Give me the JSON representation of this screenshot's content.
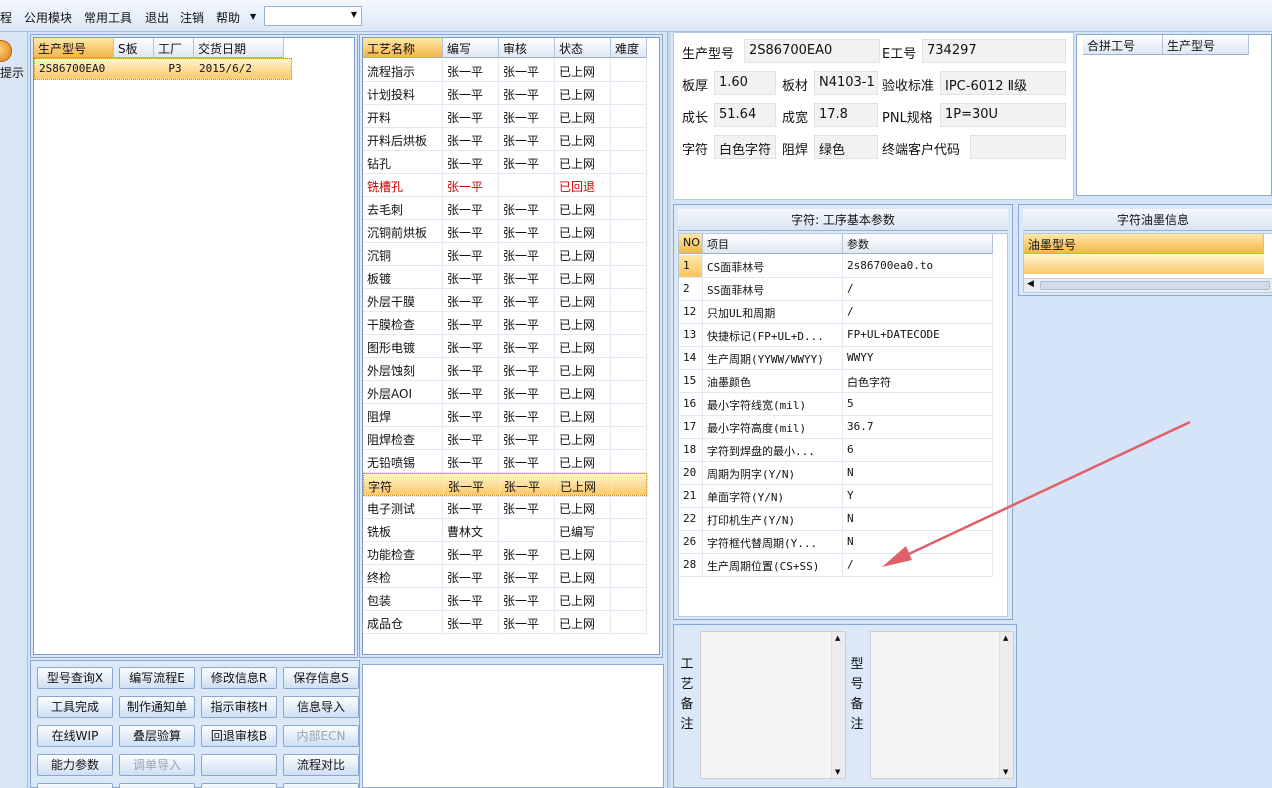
{
  "menu": {
    "items": [
      "程",
      "公用模块",
      "常用工具",
      "退出",
      "注销",
      "帮助"
    ],
    "combo_value": ""
  },
  "leftstrip": {
    "tip_label": "提示"
  },
  "order_grid": {
    "columns": [
      "生产型号",
      "S板",
      "工厂",
      "交货日期"
    ],
    "rows": [
      [
        "2S86700EA0",
        "",
        "P3",
        "2015/6/2"
      ]
    ]
  },
  "process_grid": {
    "columns": [
      "工艺名称",
      "编写",
      "审核",
      "状态",
      "难度"
    ],
    "rows": [
      [
        "流程指示",
        "张一平",
        "张一平",
        "已上网",
        ""
      ],
      [
        "计划投料",
        "张一平",
        "张一平",
        "已上网",
        ""
      ],
      [
        "开料",
        "张一平",
        "张一平",
        "已上网",
        ""
      ],
      [
        "开料后烘板",
        "张一平",
        "张一平",
        "已上网",
        ""
      ],
      [
        "钻孔",
        "张一平",
        "张一平",
        "已上网",
        ""
      ],
      [
        "铣槽孔",
        "张一平",
        "",
        "已回退",
        ""
      ],
      [
        "去毛刺",
        "张一平",
        "张一平",
        "已上网",
        ""
      ],
      [
        "沉铜前烘板",
        "张一平",
        "张一平",
        "已上网",
        ""
      ],
      [
        "沉铜",
        "张一平",
        "张一平",
        "已上网",
        ""
      ],
      [
        "板镀",
        "张一平",
        "张一平",
        "已上网",
        ""
      ],
      [
        "外层干膜",
        "张一平",
        "张一平",
        "已上网",
        ""
      ],
      [
        "干膜检查",
        "张一平",
        "张一平",
        "已上网",
        ""
      ],
      [
        "图形电镀",
        "张一平",
        "张一平",
        "已上网",
        ""
      ],
      [
        "外层蚀刻",
        "张一平",
        "张一平",
        "已上网",
        ""
      ],
      [
        "外层AOI",
        "张一平",
        "张一平",
        "已上网",
        ""
      ],
      [
        "阻焊",
        "张一平",
        "张一平",
        "已上网",
        ""
      ],
      [
        "阻焊检查",
        "张一平",
        "张一平",
        "已上网",
        ""
      ],
      [
        "无铅喷锡",
        "张一平",
        "张一平",
        "已上网",
        ""
      ],
      [
        "字符",
        "张一平",
        "张一平",
        "已上网",
        ""
      ],
      [
        "电子测试",
        "张一平",
        "张一平",
        "已上网",
        ""
      ],
      [
        "铣板",
        "曹林文",
        "",
        "已编写",
        ""
      ],
      [
        "功能检查",
        "张一平",
        "张一平",
        "已上网",
        ""
      ],
      [
        "终检",
        "张一平",
        "张一平",
        "已上网",
        ""
      ],
      [
        "包装",
        "张一平",
        "张一平",
        "已上网",
        ""
      ],
      [
        "成品仓",
        "张一平",
        "张一平",
        "已上网",
        ""
      ]
    ],
    "selected_row": 18,
    "error_row": 5
  },
  "buttons": [
    "型号查询X",
    "编写流程E",
    "修改信息R",
    "保存信息S",
    "工具完成",
    "制作通知单",
    "指示审核H",
    "信息导入",
    "在线WIP",
    "叠层验算",
    "回退审核B",
    "内部ECN",
    "能力参数",
    "调单导入",
    "",
    "流程对比"
  ],
  "disabled_buttons": [
    11,
    13
  ],
  "info": {
    "labels": [
      "生产型号",
      "E工号",
      "板厚",
      "板材",
      "验收标准",
      "成长",
      "成宽",
      "PNL规格",
      "字符",
      "阻焊",
      "终端客户代码"
    ],
    "values": [
      "2S86700EA0",
      "734297",
      "1.60",
      "N4103-1",
      "IPC-6012 Ⅱ级",
      "51.64",
      "17.8",
      "1P=30U",
      "白色字符",
      "绿色",
      ""
    ]
  },
  "merge_grid": {
    "columns": [
      "合拼工号",
      "生产型号"
    ]
  },
  "param_panel": {
    "title": "字符: 工序基本参数",
    "columns": [
      "NO",
      "项目",
      "参数"
    ],
    "rows": [
      [
        "1",
        "CS面菲林号",
        "2s86700ea0.to"
      ],
      [
        "2",
        "SS面菲林号",
        "/"
      ],
      [
        "12",
        "只加UL和周期",
        "/"
      ],
      [
        "13",
        "快捷标记(FP+UL+D...",
        "FP+UL+DATECODE"
      ],
      [
        "14",
        "生产周期(YYWW/WWYY)",
        "WWYY"
      ],
      [
        "15",
        "油墨颜色",
        "白色字符"
      ],
      [
        "16",
        "最小字符线宽(mil)",
        "5"
      ],
      [
        "17",
        "最小字符高度(mil)",
        "36.7"
      ],
      [
        "18",
        "字符到焊盘的最小...",
        "6"
      ],
      [
        "20",
        "周期为阴字(Y/N)",
        "N"
      ],
      [
        "21",
        "单面字符(Y/N)",
        "Y"
      ],
      [
        "22",
        "打印机生产(Y/N)",
        "N"
      ],
      [
        "26",
        "字符框代替周期(Y...",
        "N"
      ],
      [
        "28",
        "生产周期位置(CS+SS)",
        "/"
      ]
    ]
  },
  "ink_panel": {
    "title": "字符油墨信息",
    "columns": [
      "油墨型号"
    ]
  },
  "notes": {
    "process_label": [
      "工",
      "艺",
      "备",
      "注"
    ],
    "model_label": [
      "型",
      "号",
      "备",
      "注"
    ]
  },
  "colors": {
    "arrow": "#e0606a",
    "selection": "#f8c45c",
    "error_text": "#d10000"
  }
}
